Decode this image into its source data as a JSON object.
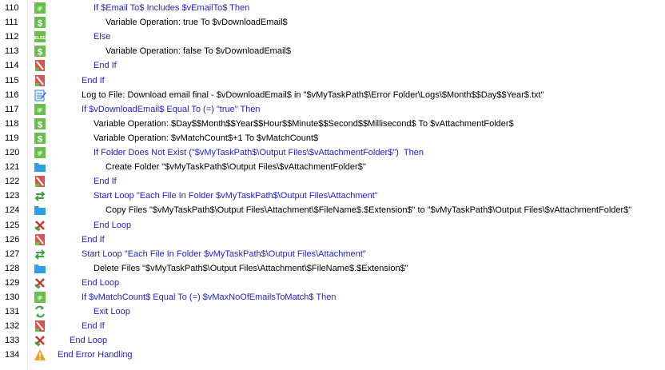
{
  "lines": [
    {
      "num": "110",
      "icon": "if-icon",
      "text": "If $Email To$ Includes $vEmailTo$ Then",
      "indent": 3,
      "color": "blue"
    },
    {
      "num": "111",
      "icon": "variable-icon",
      "text": "Variable Operation: true To $vDownloadEmail$",
      "indent": 4,
      "color": "black"
    },
    {
      "num": "112",
      "icon": "else-icon",
      "text": "Else",
      "indent": 3,
      "color": "blue"
    },
    {
      "num": "113",
      "icon": "variable-icon",
      "text": "Variable Operation: false To $vDownloadEmail$",
      "indent": 4,
      "color": "black"
    },
    {
      "num": "114",
      "icon": "end-if-icon",
      "text": "End If",
      "indent": 3,
      "color": "blue"
    },
    {
      "num": "115",
      "icon": "end-if-icon",
      "text": "End If",
      "indent": 2,
      "color": "blue"
    },
    {
      "num": "116",
      "icon": "log-file-icon",
      "text": "Log to File: Download email final - $vDownloadEmail$ in \"$vMyTaskPath$\\Error Folder\\Logs\\$Month$$Day$$Year$.txt\"",
      "indent": 2,
      "color": "black"
    },
    {
      "num": "117",
      "icon": "if-icon",
      "text": "If $vDownloadEmail$ Equal To (=) \"true\" Then",
      "indent": 2,
      "color": "blue"
    },
    {
      "num": "118",
      "icon": "variable-icon",
      "text": "Variable Operation: $Day$$Month$$Year$$Hour$$Minute$$Second$$Millisecond$ To $vAttachmentFolder$",
      "indent": 3,
      "color": "black"
    },
    {
      "num": "119",
      "icon": "variable-icon",
      "text": "Variable Operation: $vMatchCount$+1 To $vMatchCount$",
      "indent": 3,
      "color": "black"
    },
    {
      "num": "120",
      "icon": "if-icon",
      "text": "If Folder Does Not Exist (\"$vMyTaskPath$\\Output Files\\$vAttachmentFolder$\")  Then",
      "indent": 3,
      "color": "blue"
    },
    {
      "num": "121",
      "icon": "folder-icon",
      "text": "Create Folder \"$vMyTaskPath$\\Output Files\\$vAttachmentFolder$\"",
      "indent": 4,
      "color": "black"
    },
    {
      "num": "122",
      "icon": "end-if-icon",
      "text": "End If",
      "indent": 3,
      "color": "blue"
    },
    {
      "num": "123",
      "icon": "loop-icon",
      "text": "Start Loop \"Each File In Folder $vMyTaskPath$\\Output Files\\Attachment\"",
      "indent": 3,
      "color": "blue"
    },
    {
      "num": "124",
      "icon": "folder-icon",
      "text": "Copy Files \"$vMyTaskPath$\\Output Files\\Attachment\\$FileName$.$Extension$\" to \"$vMyTaskPath$\\Output Files\\$vAttachmentFolder$\"",
      "indent": 4,
      "color": "black"
    },
    {
      "num": "125",
      "icon": "end-loop-icon",
      "text": "End Loop",
      "indent": 3,
      "color": "blue"
    },
    {
      "num": "126",
      "icon": "end-if-icon",
      "text": "End If",
      "indent": 2,
      "color": "blue"
    },
    {
      "num": "127",
      "icon": "loop-icon",
      "text": "Start Loop \"Each File In Folder $vMyTaskPath$\\Output Files\\Attachment\"",
      "indent": 2,
      "color": "blue"
    },
    {
      "num": "128",
      "icon": "folder-icon",
      "text": "Delete Files \"$vMyTaskPath$\\Output Files\\Attachment\\$FileName$.$Extension$\"",
      "indent": 3,
      "color": "black"
    },
    {
      "num": "129",
      "icon": "end-loop-icon",
      "text": "End Loop",
      "indent": 2,
      "color": "blue"
    },
    {
      "num": "130",
      "icon": "if-icon",
      "text": "If $vMatchCount$ Equal To (=) $vMaxNoOfEmailsToMatch$ Then",
      "indent": 2,
      "color": "blue"
    },
    {
      "num": "131",
      "icon": "exit-loop-icon",
      "text": "Exit Loop",
      "indent": 3,
      "color": "blue"
    },
    {
      "num": "132",
      "icon": "end-if-icon",
      "text": "End If",
      "indent": 2,
      "color": "blue"
    },
    {
      "num": "133",
      "icon": "end-loop-icon",
      "text": "End Loop",
      "indent": 1,
      "color": "blue"
    },
    {
      "num": "134",
      "icon": "warning-icon",
      "text": "End Error Handling",
      "indent": 0,
      "color": "blue"
    }
  ],
  "colors": {
    "keyword_blue": "#1f1fd6",
    "if_icon_green": "#6abf4b",
    "end_icon_red": "#c0392b",
    "folder_blue": "#2e9ee6",
    "warning_orange": "#f0a020"
  }
}
